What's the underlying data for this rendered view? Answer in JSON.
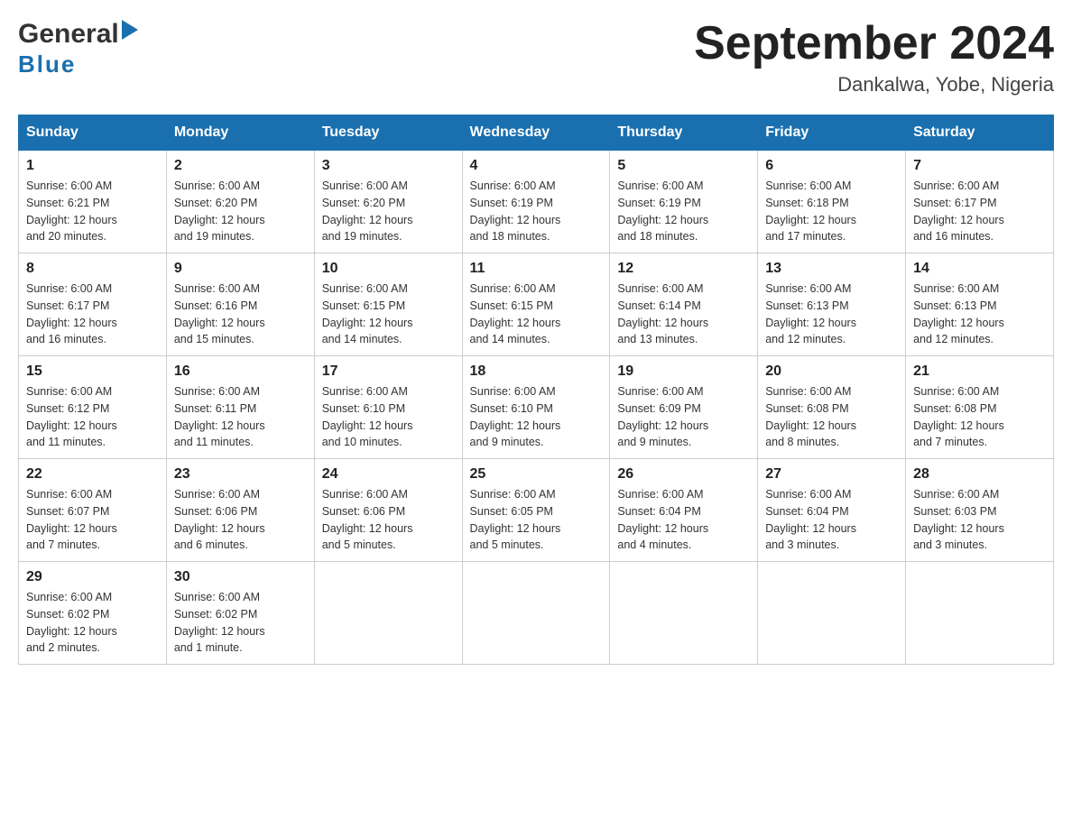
{
  "header": {
    "month_year": "September 2024",
    "location": "Dankalwa, Yobe, Nigeria",
    "logo_general": "General",
    "logo_blue": "Blue"
  },
  "weekdays": [
    "Sunday",
    "Monday",
    "Tuesday",
    "Wednesday",
    "Thursday",
    "Friday",
    "Saturday"
  ],
  "weeks": [
    [
      {
        "day": "1",
        "sunrise": "6:00 AM",
        "sunset": "6:21 PM",
        "daylight": "12 hours and 20 minutes."
      },
      {
        "day": "2",
        "sunrise": "6:00 AM",
        "sunset": "6:20 PM",
        "daylight": "12 hours and 19 minutes."
      },
      {
        "day": "3",
        "sunrise": "6:00 AM",
        "sunset": "6:20 PM",
        "daylight": "12 hours and 19 minutes."
      },
      {
        "day": "4",
        "sunrise": "6:00 AM",
        "sunset": "6:19 PM",
        "daylight": "12 hours and 18 minutes."
      },
      {
        "day": "5",
        "sunrise": "6:00 AM",
        "sunset": "6:19 PM",
        "daylight": "12 hours and 18 minutes."
      },
      {
        "day": "6",
        "sunrise": "6:00 AM",
        "sunset": "6:18 PM",
        "daylight": "12 hours and 17 minutes."
      },
      {
        "day": "7",
        "sunrise": "6:00 AM",
        "sunset": "6:17 PM",
        "daylight": "12 hours and 16 minutes."
      }
    ],
    [
      {
        "day": "8",
        "sunrise": "6:00 AM",
        "sunset": "6:17 PM",
        "daylight": "12 hours and 16 minutes."
      },
      {
        "day": "9",
        "sunrise": "6:00 AM",
        "sunset": "6:16 PM",
        "daylight": "12 hours and 15 minutes."
      },
      {
        "day": "10",
        "sunrise": "6:00 AM",
        "sunset": "6:15 PM",
        "daylight": "12 hours and 14 minutes."
      },
      {
        "day": "11",
        "sunrise": "6:00 AM",
        "sunset": "6:15 PM",
        "daylight": "12 hours and 14 minutes."
      },
      {
        "day": "12",
        "sunrise": "6:00 AM",
        "sunset": "6:14 PM",
        "daylight": "12 hours and 13 minutes."
      },
      {
        "day": "13",
        "sunrise": "6:00 AM",
        "sunset": "6:13 PM",
        "daylight": "12 hours and 12 minutes."
      },
      {
        "day": "14",
        "sunrise": "6:00 AM",
        "sunset": "6:13 PM",
        "daylight": "12 hours and 12 minutes."
      }
    ],
    [
      {
        "day": "15",
        "sunrise": "6:00 AM",
        "sunset": "6:12 PM",
        "daylight": "12 hours and 11 minutes."
      },
      {
        "day": "16",
        "sunrise": "6:00 AM",
        "sunset": "6:11 PM",
        "daylight": "12 hours and 11 minutes."
      },
      {
        "day": "17",
        "sunrise": "6:00 AM",
        "sunset": "6:10 PM",
        "daylight": "12 hours and 10 minutes."
      },
      {
        "day": "18",
        "sunrise": "6:00 AM",
        "sunset": "6:10 PM",
        "daylight": "12 hours and 9 minutes."
      },
      {
        "day": "19",
        "sunrise": "6:00 AM",
        "sunset": "6:09 PM",
        "daylight": "12 hours and 9 minutes."
      },
      {
        "day": "20",
        "sunrise": "6:00 AM",
        "sunset": "6:08 PM",
        "daylight": "12 hours and 8 minutes."
      },
      {
        "day": "21",
        "sunrise": "6:00 AM",
        "sunset": "6:08 PM",
        "daylight": "12 hours and 7 minutes."
      }
    ],
    [
      {
        "day": "22",
        "sunrise": "6:00 AM",
        "sunset": "6:07 PM",
        "daylight": "12 hours and 7 minutes."
      },
      {
        "day": "23",
        "sunrise": "6:00 AM",
        "sunset": "6:06 PM",
        "daylight": "12 hours and 6 minutes."
      },
      {
        "day": "24",
        "sunrise": "6:00 AM",
        "sunset": "6:06 PM",
        "daylight": "12 hours and 5 minutes."
      },
      {
        "day": "25",
        "sunrise": "6:00 AM",
        "sunset": "6:05 PM",
        "daylight": "12 hours and 5 minutes."
      },
      {
        "day": "26",
        "sunrise": "6:00 AM",
        "sunset": "6:04 PM",
        "daylight": "12 hours and 4 minutes."
      },
      {
        "day": "27",
        "sunrise": "6:00 AM",
        "sunset": "6:04 PM",
        "daylight": "12 hours and 3 minutes."
      },
      {
        "day": "28",
        "sunrise": "6:00 AM",
        "sunset": "6:03 PM",
        "daylight": "12 hours and 3 minutes."
      }
    ],
    [
      {
        "day": "29",
        "sunrise": "6:00 AM",
        "sunset": "6:02 PM",
        "daylight": "12 hours and 2 minutes."
      },
      {
        "day": "30",
        "sunrise": "6:00 AM",
        "sunset": "6:02 PM",
        "daylight": "12 hours and 1 minute."
      },
      null,
      null,
      null,
      null,
      null
    ]
  ],
  "labels": {
    "sunrise": "Sunrise:",
    "sunset": "Sunset:",
    "daylight": "Daylight:"
  }
}
